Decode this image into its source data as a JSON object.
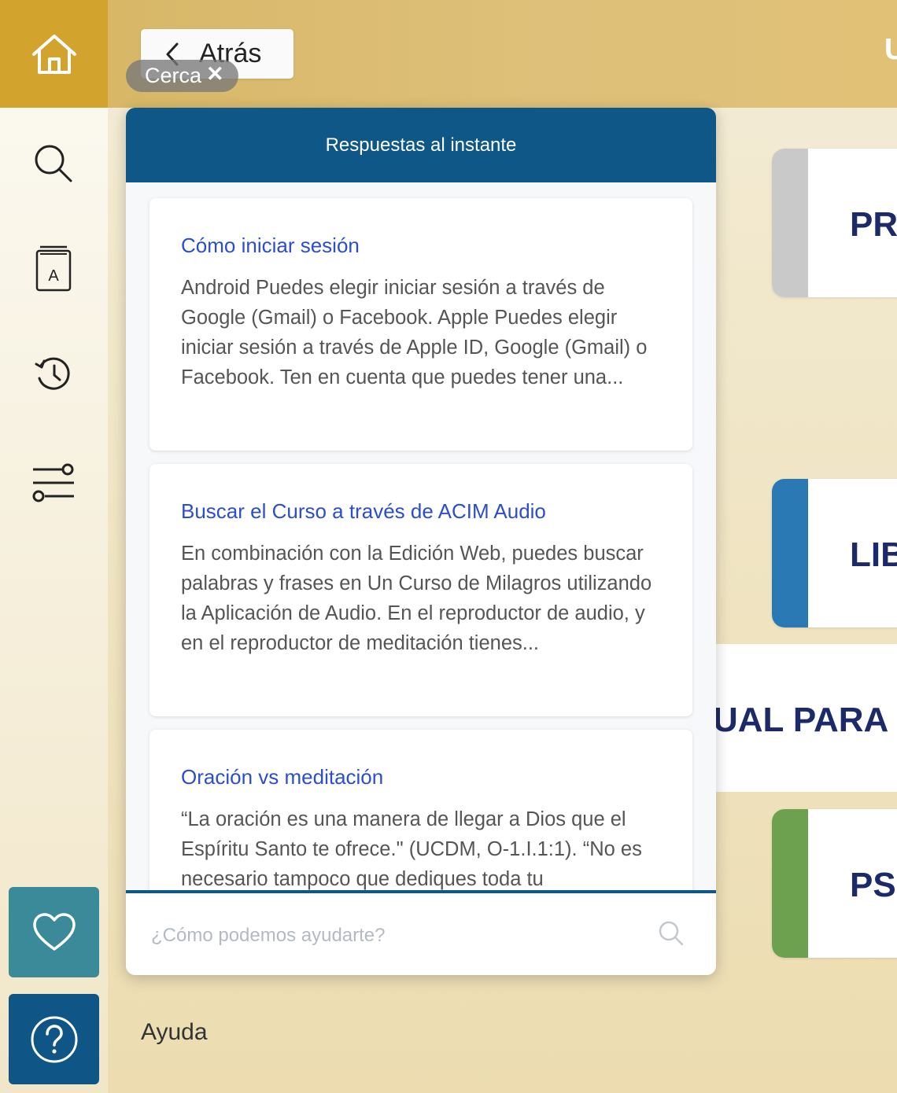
{
  "nav": {
    "back_label": "Atrás",
    "close_label": "Cerca",
    "help_label": "Ayuda",
    "icons": [
      "home-icon",
      "search-icon",
      "book-icon",
      "history-icon",
      "filter-icon",
      "heart-icon",
      "help-icon"
    ]
  },
  "widget": {
    "title": "Respuestas al instante",
    "articles": [
      {
        "title": "Cómo iniciar sesión",
        "excerpt": "Android Puedes elegir iniciar sesión a través de Google (Gmail) o Facebook. Apple Puedes elegir iniciar sesión a través de Apple ID, Google (Gmail) o Facebook. Ten en cuenta que puedes tener una..."
      },
      {
        "title": "Buscar el Curso a través de ACIM Audio",
        "excerpt": "En combinación con la Edición Web, puedes buscar palabras y frases en Un Curso de Milagros utilizando la Aplicación de Audio. En el reproductor de audio, y en el reproductor de meditación tienes..."
      },
      {
        "title": "Oración vs meditación",
        "excerpt": "“La oración es una manera de llegar a Dios que el Espíritu Santo te ofrece.\" (UCDM, O-1.I.1:1). “No es necesario tampoco que dediques toda tu"
      }
    ],
    "search": {
      "placeholder": "¿Cómo podemos ayudarte?",
      "value": ""
    }
  },
  "background": {
    "top_partial": "U",
    "cards": [
      {
        "label": "PRI",
        "color": "#c9c9c9"
      },
      {
        "label": "LIB",
        "color": "#2a78b4"
      },
      {
        "label": "UAL PARA E",
        "color": ""
      },
      {
        "label": "PSI",
        "color": "#6ea14f"
      }
    ]
  },
  "colors": {
    "accent_gold": "#d2a42e",
    "header_blue": "#0e5786",
    "link_blue": "#2b4dd0"
  }
}
